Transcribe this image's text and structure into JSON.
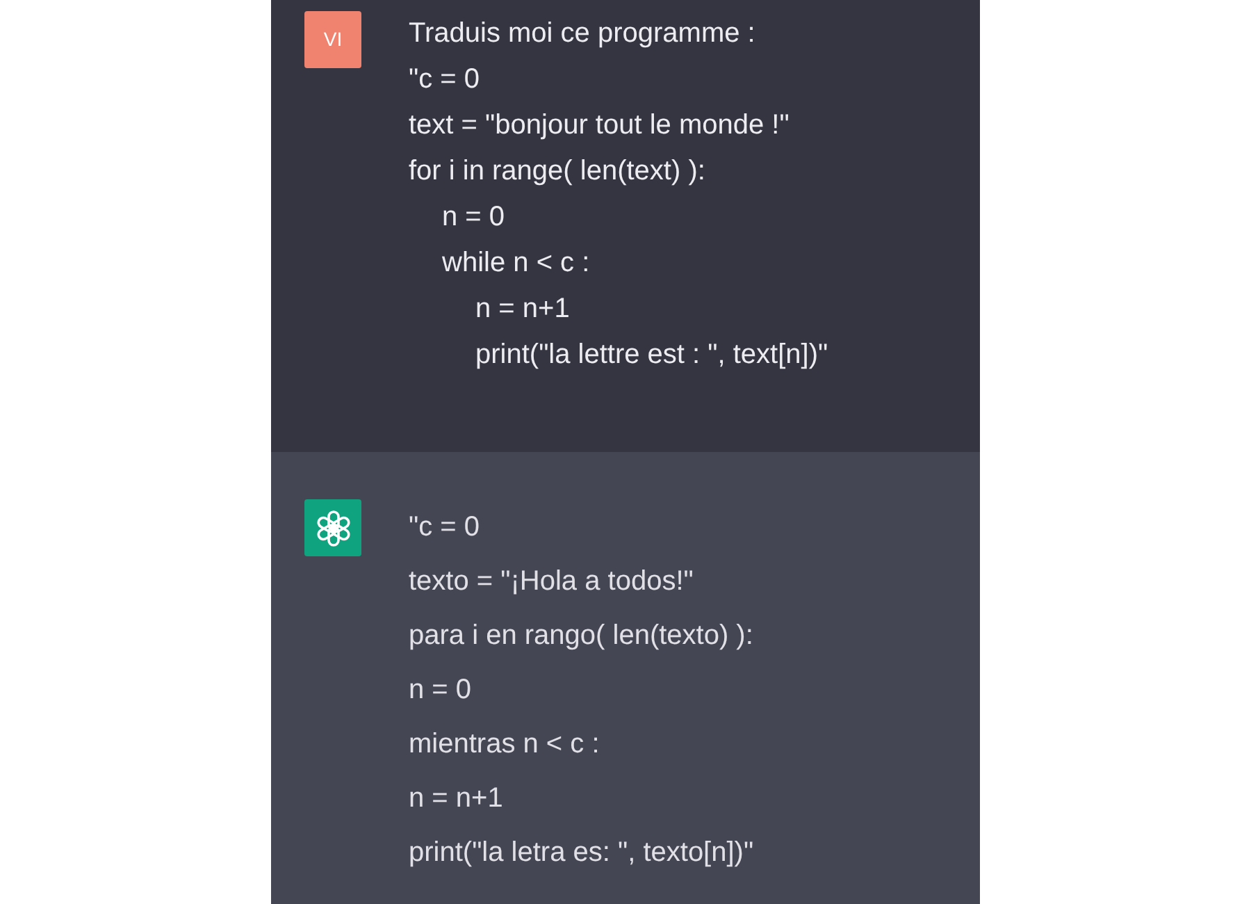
{
  "messages": [
    {
      "kind": "user",
      "avatar": "VI",
      "lines": [
        {
          "text": "Traduis moi ce programme :"
        },
        {
          "text": "\"c = 0"
        },
        {
          "text": "text = \"bonjour tout le monde !\""
        },
        {
          "text": "for i in range( len(text) ):",
          "children": [
            {
              "text": "n = 0"
            },
            {
              "text": "while n < c :",
              "children": [
                {
                  "text": "n = n+1"
                },
                {
                  "text": "print(\"la lettre est : \", text[n])\""
                }
              ]
            }
          ]
        }
      ]
    },
    {
      "kind": "assistant",
      "lines": [
        {
          "text": "\"c = 0"
        },
        {
          "text": "texto = \"¡Hola a todos!\""
        },
        {
          "text": "para i en rango( len(texto) ):"
        },
        {
          "text": "n = 0"
        },
        {
          "text": "mientras n < c :"
        },
        {
          "text": "n = n+1"
        },
        {
          "text": "print(\"la letra es: \", texto[n])\""
        }
      ]
    }
  ]
}
